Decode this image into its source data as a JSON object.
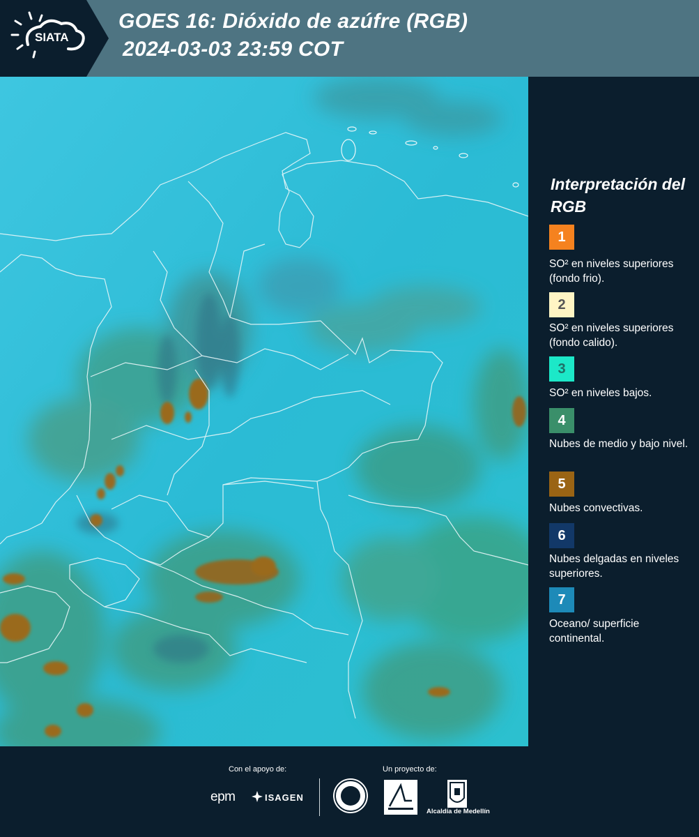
{
  "header": {
    "logo_text": "SIATA",
    "title_line1": "GOES 16: Dióxido de azúfre (RGB)",
    "title_line2": "2024-03-03 23:59 COT"
  },
  "legend": {
    "title": "Interpretación del RGB",
    "items": [
      {
        "number": "1",
        "color": "#f5821f",
        "number_color": "#ffffff",
        "text": "SO² en niveles superiores (fondo frio)."
      },
      {
        "number": "2",
        "color": "#fff5c4",
        "number_color": "#555555",
        "text": "SO² en niveles superiores (fondo calido)."
      },
      {
        "number": "3",
        "color": "#1ce8c8",
        "number_color": "#1f6f66",
        "text": "SO² en niveles bajos."
      },
      {
        "number": "4",
        "color": "#3a8f6a",
        "number_color": "#ffffff",
        "text": "Nubes de medio y bajo nivel."
      },
      {
        "number": "5",
        "color": "#9a6414",
        "number_color": "#ffffff",
        "text": "Nubes convectivas."
      },
      {
        "number": "6",
        "color": "#123868",
        "number_color": "#ffffff",
        "text": "Nubes delgadas en niveles superiores."
      },
      {
        "number": "7",
        "color": "#1d8ab8",
        "number_color": "#ffffff",
        "text": "Oceano/ superficie continental."
      }
    ]
  },
  "footer": {
    "support_label": "Con el apoyo de:",
    "project_label": "Un proyecto de:",
    "epm": "epm",
    "isagen": "ISAGEN",
    "alcaldia": "Alcaldía de Medellín"
  }
}
